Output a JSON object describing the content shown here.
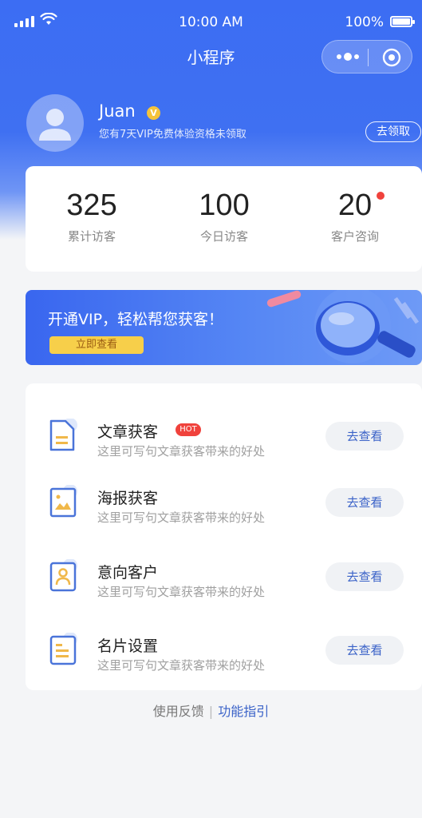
{
  "status_bar": {
    "time": "10:00 AM",
    "battery": "100%"
  },
  "nav": {
    "title": "小程序"
  },
  "profile": {
    "name": "Juan",
    "badge": "V",
    "tip": "您有7天VIP免费体验资格未领取",
    "claim_label": "去领取"
  },
  "stats": [
    {
      "value": "325",
      "label": "累计访客"
    },
    {
      "value": "100",
      "label": "今日访客"
    },
    {
      "value": "20",
      "label": "客户咨询"
    }
  ],
  "banner": {
    "title": "开通VIP，轻松帮您获客！",
    "button": "立即查看"
  },
  "list": [
    {
      "title": "文章获客",
      "desc": "这里可写句文章获客带来的好处",
      "tag": "HOT",
      "action": "去查看",
      "icon": "document-icon"
    },
    {
      "title": "海报获客",
      "desc": "这里可写句文章获客带来的好处",
      "action": "去查看",
      "icon": "image-icon"
    },
    {
      "title": "意向客户",
      "desc": "这里可写句文章获客带来的好处",
      "action": "去查看",
      "icon": "user-card-icon"
    },
    {
      "title": "名片设置",
      "desc": "这里可写句文章获客带来的好处",
      "action": "去查看",
      "icon": "card-settings-icon"
    }
  ],
  "footer": {
    "feedback": "使用反馈",
    "separator": "|",
    "guide": "功能指引"
  },
  "colors": {
    "primary": "#3c6df3",
    "accent_yellow": "#f7cf4a",
    "hot_red": "#f0423c",
    "link_blue": "#3a62c8"
  }
}
